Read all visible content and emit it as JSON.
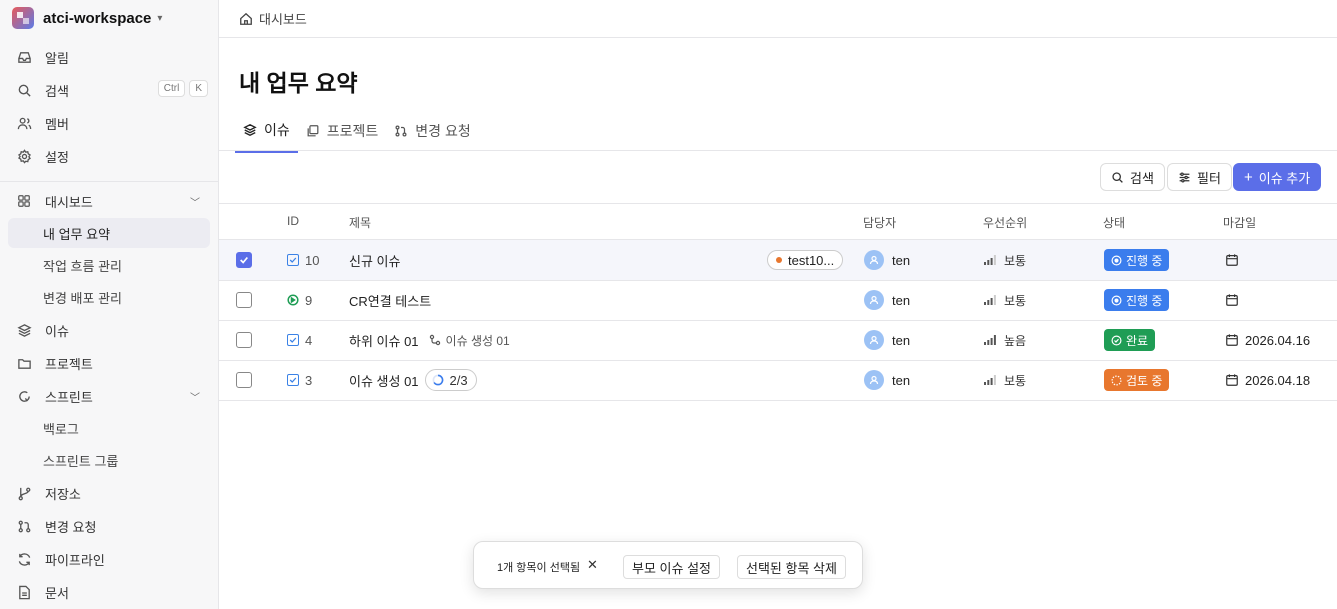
{
  "workspace": {
    "name": "atci-workspace"
  },
  "sidebar": {
    "top": [
      {
        "label": "알림",
        "icon": "inbox-icon"
      },
      {
        "label": "검색",
        "icon": "search-icon",
        "shortcut": [
          "Ctrl",
          "K"
        ]
      },
      {
        "label": "멤버",
        "icon": "users-icon"
      },
      {
        "label": "설정",
        "icon": "gear-icon"
      }
    ],
    "dashboard": {
      "label": "대시보드",
      "items": [
        "내 업무 요약",
        "작업 흐름 관리",
        "변경 배포 관리"
      ]
    },
    "issues": "이슈",
    "projects": "프로젝트",
    "sprint": {
      "label": "스프린트",
      "items": [
        "백로그",
        "스프린트 그룹"
      ]
    },
    "repo": "저장소",
    "change_request": "변경 요청",
    "pipeline": "파이프라인",
    "docs": "문서"
  },
  "breadcrumb": "대시보드",
  "page_title": "내 업무 요약",
  "tabs": [
    "이슈",
    "프로젝트",
    "변경 요청"
  ],
  "toolbar": {
    "search": "검색",
    "filter": "필터",
    "add": "이슈 추가"
  },
  "columns": {
    "id": "ID",
    "title": "제목",
    "assignee": "담당자",
    "priority": "우선순위",
    "status": "상태",
    "due": "마감일"
  },
  "rows": [
    {
      "selected": true,
      "id": "10",
      "title": "신규 이슈",
      "tag": "test10...",
      "assignee": "ten",
      "priority": "보통",
      "status": "진행 중",
      "status_color": "#3b7ded",
      "due": ""
    },
    {
      "selected": false,
      "id": "9",
      "title": "CR연결 테스트",
      "assignee": "ten",
      "priority": "보통",
      "status": "진행 중",
      "status_color": "#3b7ded",
      "due": ""
    },
    {
      "selected": false,
      "id": "4",
      "title": "하위 이슈 01",
      "parent": "이슈 생성 01",
      "assignee": "ten",
      "priority": "높음",
      "status": "완료",
      "status_color": "#1f9d55",
      "due": "2026.04.16"
    },
    {
      "selected": false,
      "id": "3",
      "title": "이슈 생성 01",
      "progress": "2/3",
      "assignee": "ten",
      "priority": "보통",
      "status": "검토 중",
      "status_color": "#e8772e",
      "due": "2026.04.18"
    }
  ],
  "bulk": {
    "text": "1개 항목이 선택됨",
    "set_parent": "부모 이슈 설정",
    "delete": "선택된 항목 삭제"
  }
}
